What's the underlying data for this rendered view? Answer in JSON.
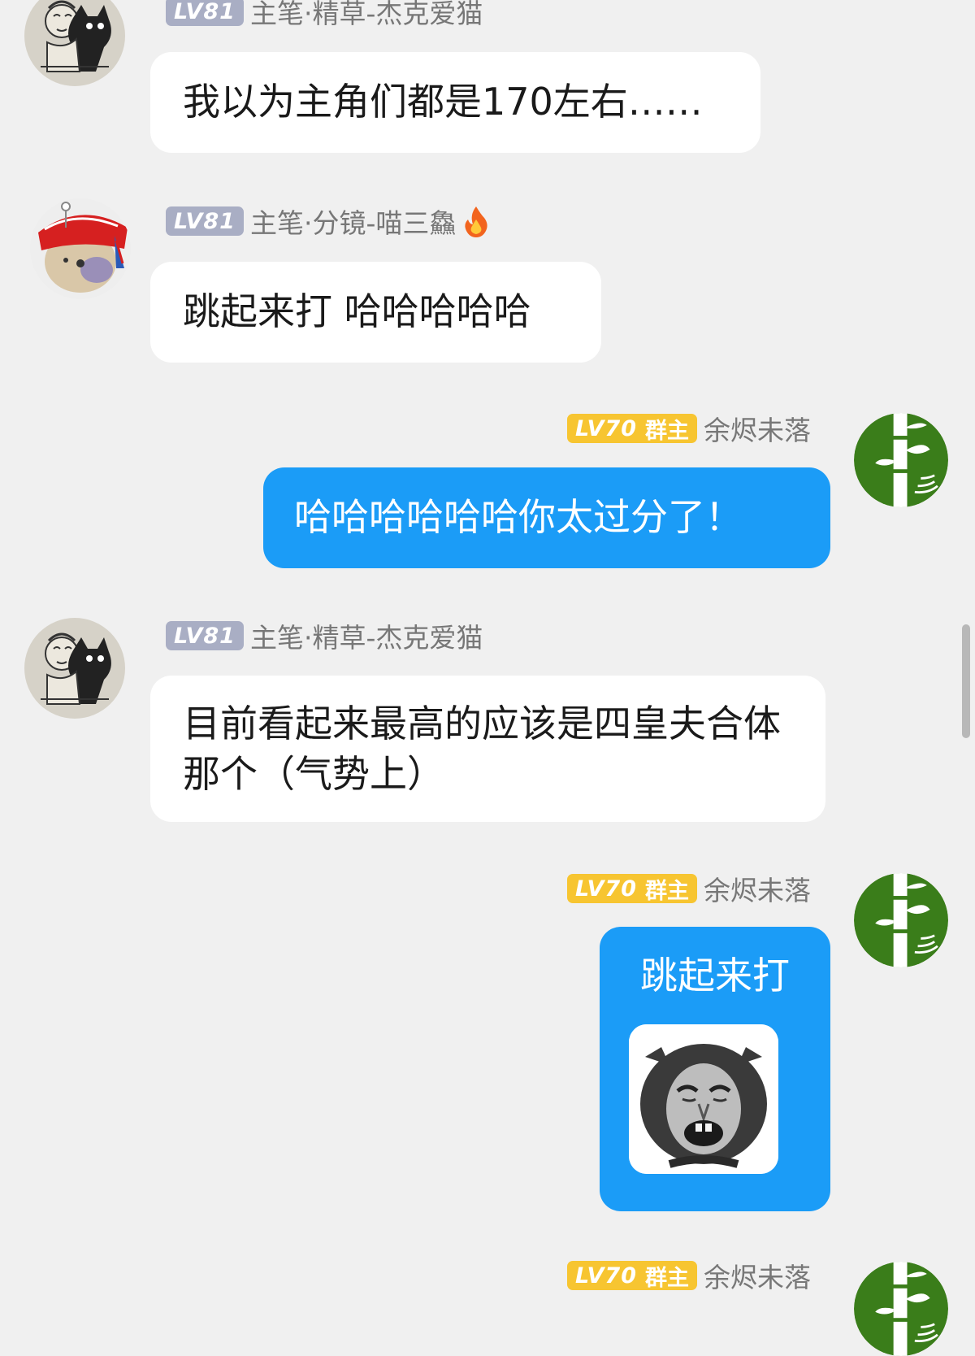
{
  "messages": [
    {
      "direction": "incoming",
      "level": "LV81",
      "sender": "主笔·精草-杰克爱猫",
      "avatar_icon": "cat-cartoon-avatar",
      "text": "我以为主角们都是170左右……"
    },
    {
      "direction": "incoming",
      "level": "LV81",
      "sender": "主笔·分镜-喵三鱻",
      "sender_icon": "fire-icon",
      "avatar_icon": "red-hat-dog-avatar",
      "text": "跳起来打 哈哈哈哈哈"
    },
    {
      "direction": "outgoing",
      "level": "LV70",
      "role": "群主",
      "sender": "余烬未落",
      "avatar_icon": "bamboo-avatar",
      "text": "哈哈哈哈哈哈你太过分了！"
    },
    {
      "direction": "incoming",
      "level": "LV81",
      "sender": "主笔·精草-杰克爱猫",
      "avatar_icon": "cat-cartoon-avatar",
      "text": "目前看起来最高的应该是四皇夫合体那个（气势上）"
    },
    {
      "direction": "outgoing",
      "level": "LV70",
      "role": "群主",
      "sender": "余烬未落",
      "avatar_icon": "bamboo-avatar",
      "sticker_caption": "跳起来打",
      "sticker_icon": "crying-face-meme-sticker"
    },
    {
      "direction": "outgoing",
      "level": "LV70",
      "role": "群主",
      "sender": "余烬未落",
      "avatar_icon": "bamboo-avatar"
    }
  ],
  "colors": {
    "background": "#f0f0f0",
    "incoming_bubble": "#ffffff",
    "outgoing_bubble": "#1b9cf7",
    "badge_lv81": "#a9aec4",
    "badge_lv70": "#f7c531"
  }
}
